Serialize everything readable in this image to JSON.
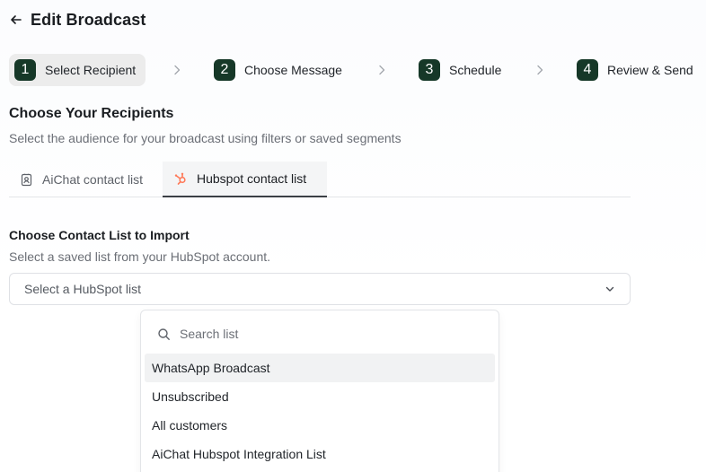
{
  "header": {
    "title": "Edit Broadcast",
    "back_icon": "arrow-left-icon"
  },
  "stepper": {
    "steps": [
      {
        "number": "1",
        "label": "Select Recipient",
        "active": true
      },
      {
        "number": "2",
        "label": "Choose Message",
        "active": false
      },
      {
        "number": "3",
        "label": "Schedule",
        "active": false
      },
      {
        "number": "4",
        "label": "Review & Send",
        "active": false
      }
    ],
    "separator_icon": "chevron-right-icon",
    "badge_color": "#163828"
  },
  "recipients": {
    "title": "Choose Your Recipients",
    "subtitle": "Select the audience for your broadcast using filters or saved segments"
  },
  "tabs": [
    {
      "label": "AiChat contact list",
      "icon": "contact-book-icon",
      "active": false
    },
    {
      "label": "Hubspot contact list",
      "icon": "hubspot-icon",
      "active": true,
      "icon_color": "#ff7a59"
    }
  ],
  "import": {
    "label": "Choose Contact List to Import",
    "help": "Select a saved list from your HubSpot account.",
    "select_placeholder": "Select a HubSpot list",
    "select_icon": "chevron-down-icon"
  },
  "dropdown": {
    "search_placeholder": "Search list",
    "search_icon": "search-icon",
    "options": [
      "WhatsApp Broadcast",
      "Unsubscribed",
      "All customers",
      "AiChat Hubspot Integration List"
    ],
    "highlighted_index": 0
  }
}
